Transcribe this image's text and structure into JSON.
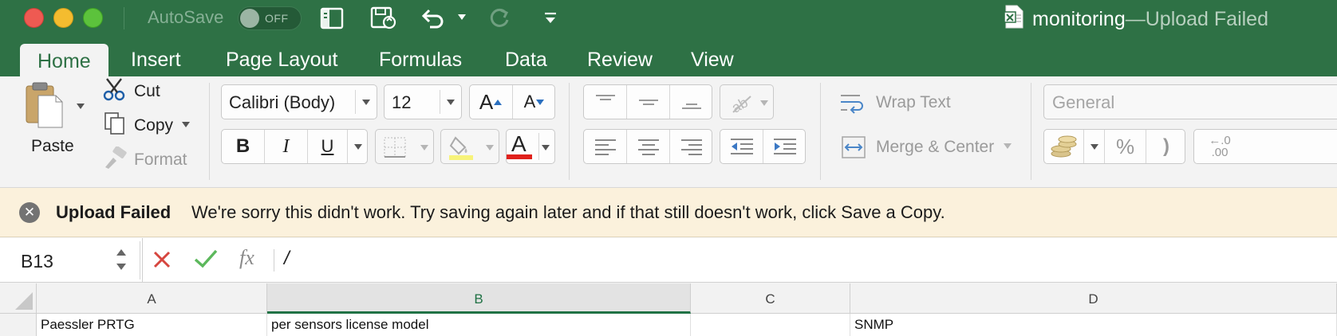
{
  "titlebar": {
    "autosave_label": "AutoSave",
    "autosave_state": "OFF",
    "doc_name": "monitoring",
    "title_separator": " — ",
    "status": "Upload Failed"
  },
  "tabs": [
    {
      "label": "Home",
      "active": true
    },
    {
      "label": "Insert"
    },
    {
      "label": "Page Layout"
    },
    {
      "label": "Formulas"
    },
    {
      "label": "Data"
    },
    {
      "label": "Review"
    },
    {
      "label": "View"
    }
  ],
  "clipboard": {
    "paste": "Paste",
    "cut": "Cut",
    "copy": "Copy",
    "format": "Format"
  },
  "font": {
    "name": "Calibri (Body)",
    "size": "12",
    "bold": "B",
    "italic": "I",
    "underline": "U",
    "grow": "A",
    "shrink": "A",
    "font_color_glyph": "A",
    "font_color": "#e0201b",
    "highlight_color": "#f7f37a"
  },
  "alignment": {
    "wrap_text": "Wrap Text",
    "merge_center": "Merge & Center"
  },
  "number": {
    "format": "General",
    "percent": "%",
    "comma": ")",
    "inc_decimal_top": "←.0",
    "inc_decimal_bottom": ".00"
  },
  "message": {
    "title": "Upload Failed",
    "text": "We're sorry this didn't work. Try saving again later and if that still doesn't work, click Save a Copy."
  },
  "formula_bar": {
    "name_box": "B13",
    "fx": "fx",
    "content": "/"
  },
  "grid": {
    "columns": [
      "A",
      "B",
      "C",
      "D"
    ],
    "selected_column": "B",
    "row_values": [
      "Paessler PRTG",
      "per sensors license model",
      "",
      "SNMP"
    ]
  },
  "colors": {
    "brand_green": "#2e7145",
    "message_bg": "#fbf1dc"
  }
}
